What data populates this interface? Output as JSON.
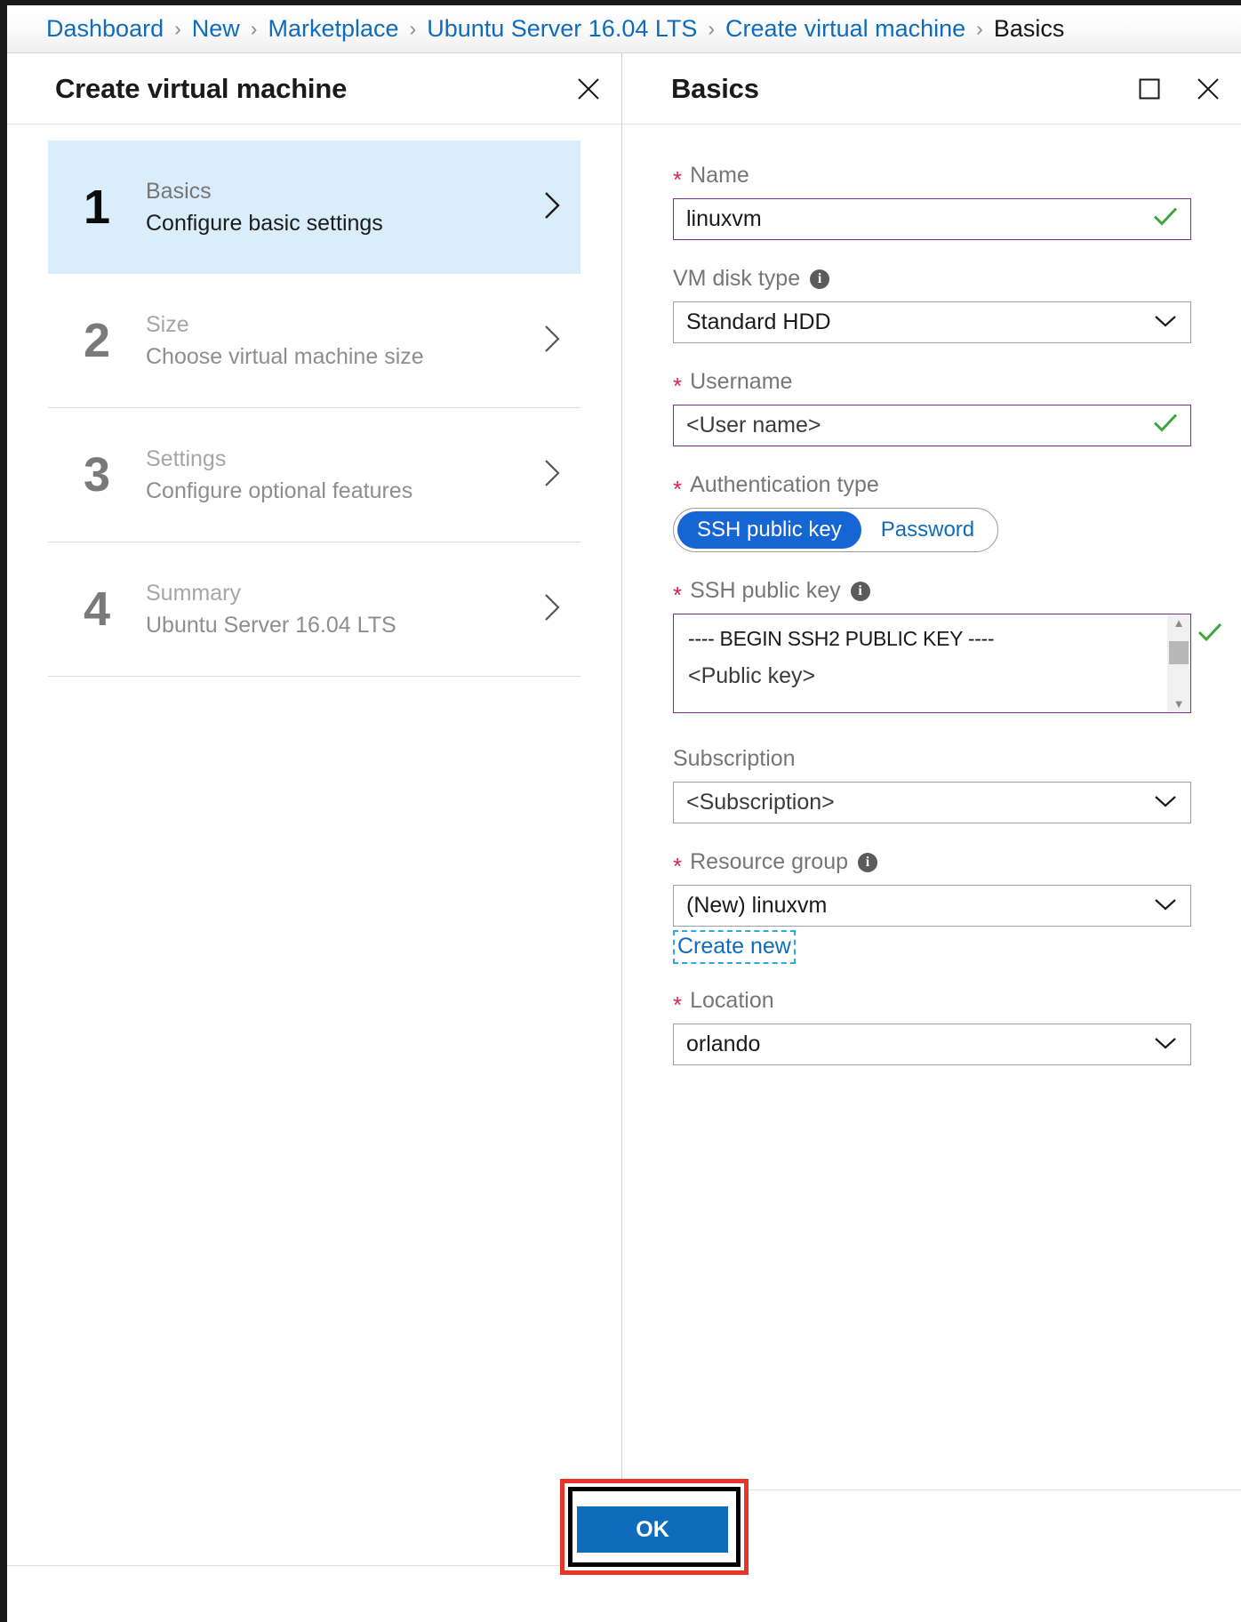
{
  "breadcrumb": {
    "items": [
      {
        "label": "Dashboard",
        "current": false
      },
      {
        "label": "New",
        "current": false
      },
      {
        "label": "Marketplace",
        "current": false
      },
      {
        "label": "Ubuntu Server 16.04 LTS",
        "current": false
      },
      {
        "label": "Create virtual machine",
        "current": false
      },
      {
        "label": "Basics",
        "current": true
      }
    ],
    "separator": "›"
  },
  "left_blade": {
    "title": "Create virtual machine",
    "close_icon": "close-icon",
    "steps": [
      {
        "num": "1",
        "title": "Basics",
        "desc": "Configure basic settings",
        "active": true
      },
      {
        "num": "2",
        "title": "Size",
        "desc": "Choose virtual machine size",
        "active": false
      },
      {
        "num": "3",
        "title": "Settings",
        "desc": "Configure optional features",
        "active": false
      },
      {
        "num": "4",
        "title": "Summary",
        "desc": "Ubuntu Server 16.04 LTS",
        "active": false
      }
    ]
  },
  "right_blade": {
    "title": "Basics",
    "maximize_icon": "maximize-icon",
    "close_icon": "close-icon",
    "fields": {
      "name": {
        "label": "Name",
        "required": true,
        "value": "linuxvm",
        "valid": true
      },
      "vm_disk_type": {
        "label": "VM disk type",
        "required": false,
        "info": true,
        "value": "Standard HDD"
      },
      "username": {
        "label": "Username",
        "required": true,
        "value": "<User name>",
        "valid": true
      },
      "authentication_type": {
        "label": "Authentication type",
        "required": true,
        "options": [
          "SSH public key",
          "Password"
        ],
        "selected": "SSH public key"
      },
      "ssh_public_key": {
        "label": "SSH public key",
        "required": true,
        "info": true,
        "line1": "---- BEGIN SSH2 PUBLIC KEY ----",
        "line2": "<Public key>",
        "valid": true
      },
      "subscription": {
        "label": "Subscription",
        "required": false,
        "value": "<Subscription>"
      },
      "resource_group": {
        "label": "Resource group",
        "required": true,
        "info": true,
        "value": "(New) linuxvm",
        "create_new_label": "Create new"
      },
      "location": {
        "label": "Location",
        "required": true,
        "value": "orlando"
      }
    },
    "ok_button": "OK"
  },
  "colors": {
    "accent_blue": "#0f6cbd",
    "valid_purple": "#7b2d96",
    "check_green": "#3da63d",
    "required_red": "#d6264c",
    "annotation_red": "#e8352a",
    "active_step_bg": "#d9edfb",
    "toggle_selected": "#1566d4"
  }
}
